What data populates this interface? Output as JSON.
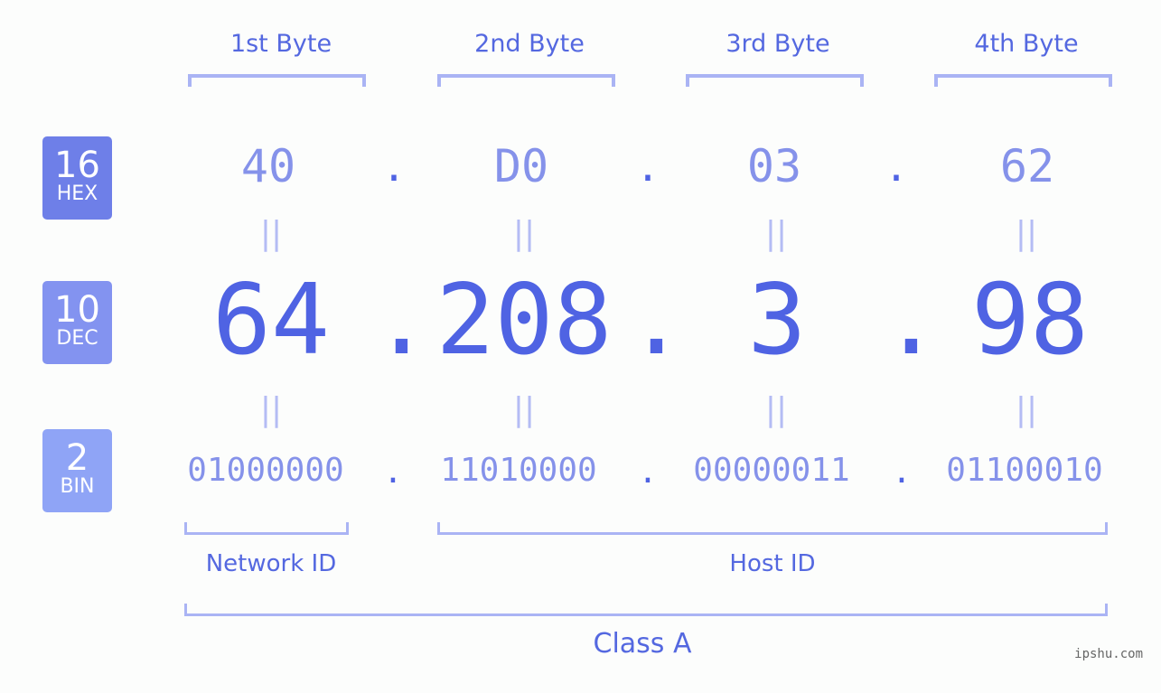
{
  "byte_headers": [
    "1st Byte",
    "2nd Byte",
    "3rd Byte",
    "4th Byte"
  ],
  "badges": [
    {
      "base": "16",
      "label": "HEX",
      "color": "#6e7fe8"
    },
    {
      "base": "10",
      "label": "DEC",
      "color": "#8393f0"
    },
    {
      "base": "2",
      "label": "BIN",
      "color": "#8fa4f6"
    }
  ],
  "hex": [
    "40",
    "D0",
    "03",
    "62"
  ],
  "dec": [
    "64",
    "208",
    "3",
    "98"
  ],
  "bin": [
    "01000000",
    "11010000",
    "00000011",
    "01100010"
  ],
  "separator": ".",
  "equals": "||",
  "network_label": "Network ID",
  "host_label": "Host ID",
  "class_label": "Class A",
  "watermark": "ipshu.com"
}
